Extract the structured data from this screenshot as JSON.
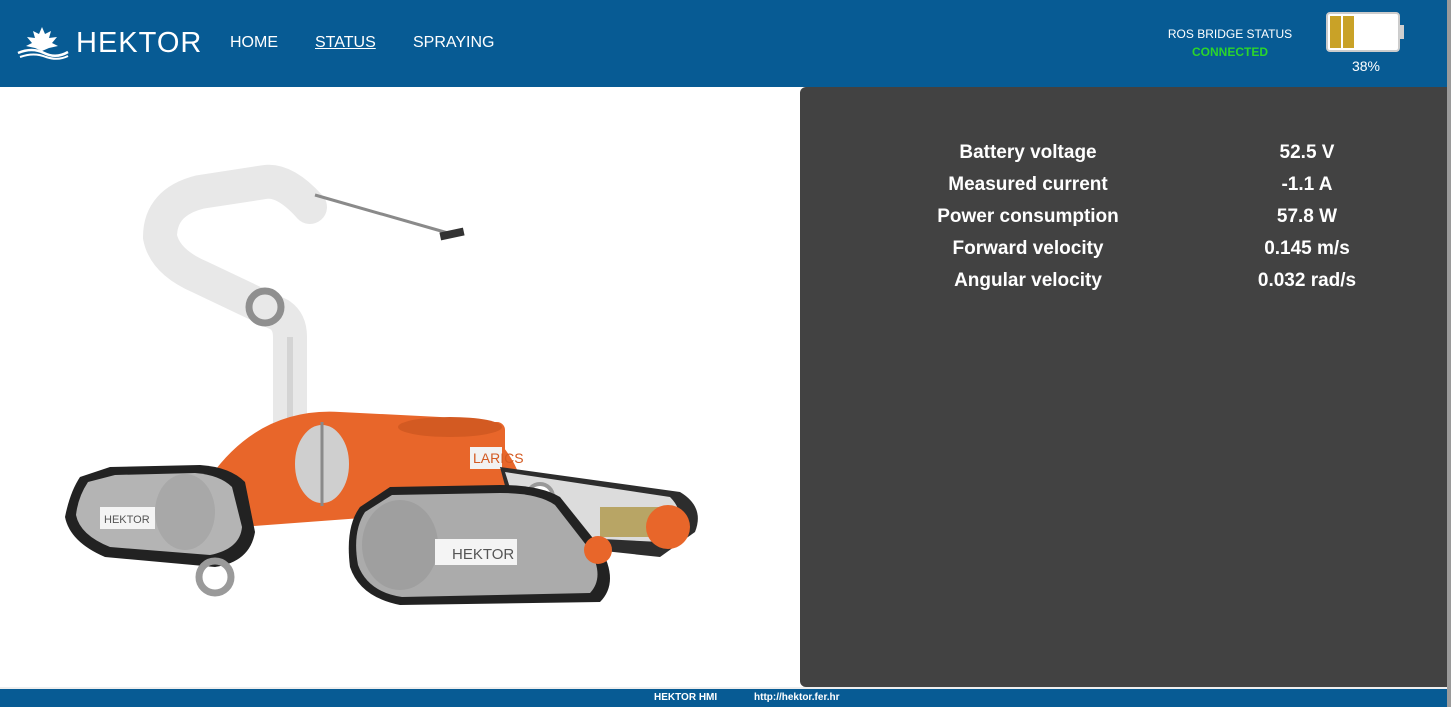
{
  "header": {
    "app_name": "HEKTOR",
    "nav": [
      {
        "label": "HOME"
      },
      {
        "label": "STATUS"
      },
      {
        "label": "SPRAYING"
      }
    ],
    "ros_bridge": {
      "label": "ROS BRIDGE STATUS",
      "state": "CONNECTED",
      "state_color": "#2bd52b"
    },
    "battery": {
      "percent_label": "38%",
      "level": 0.38
    }
  },
  "robot_view": {
    "image": "robot-3d-model",
    "decal_text": "HEKTOR",
    "brand_text": "LARICS"
  },
  "status": {
    "rows": [
      {
        "label": "Battery voltage",
        "value": "52.5 V"
      },
      {
        "label": "Measured current",
        "value": "-1.1 A"
      },
      {
        "label": "Power consumption",
        "value": "57.8 W"
      },
      {
        "label": "Forward velocity",
        "value": "0.145 m/s"
      },
      {
        "label": "Angular velocity",
        "value": "0.032 rad/s"
      }
    ]
  },
  "footer": {
    "title": "HEKTOR HMI",
    "url": "http://hektor.fer.hr"
  },
  "colors": {
    "header_bg": "#075b94",
    "panel_bg": "#424242"
  }
}
